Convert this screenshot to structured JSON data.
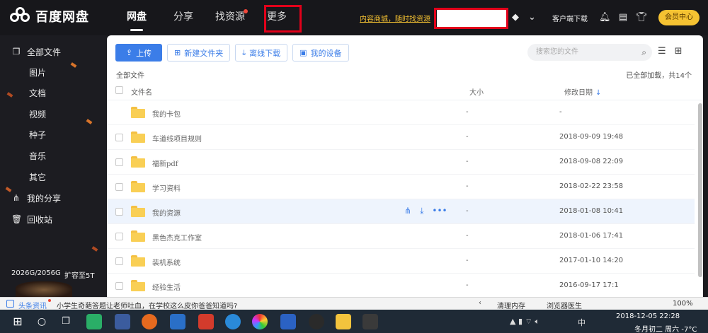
{
  "app": {
    "logo_text": "百度网盘"
  },
  "nav": {
    "items": [
      {
        "label": "网盘"
      },
      {
        "label": "分享"
      },
      {
        "label": "找资源"
      },
      {
        "label": "更多"
      }
    ]
  },
  "header": {
    "promo_link": "内容商城，随时找资源",
    "client_download": "客户端下载",
    "vip_button": "会员中心"
  },
  "sidebar": {
    "items": [
      {
        "label": "全部文件",
        "icon": "all-files-icon"
      },
      {
        "label": "图片"
      },
      {
        "label": "文档"
      },
      {
        "label": "视频"
      },
      {
        "label": "种子"
      },
      {
        "label": "音乐"
      },
      {
        "label": "其它"
      },
      {
        "label": "我的分享",
        "icon": "share-icon"
      },
      {
        "label": "回收站",
        "icon": "trash-icon"
      }
    ],
    "storage": "2026G/2056G",
    "expand": "扩容至5T"
  },
  "toolbar": {
    "upload": "上传",
    "new_folder": "新建文件夹",
    "offline_download": "离线下载",
    "my_devices": "我的设备"
  },
  "search": {
    "placeholder": "搜索您的文件"
  },
  "breadcrumb": "全部文件",
  "loaded_status": "已全部加载，共14个",
  "table": {
    "headers": {
      "name": "文件名",
      "size": "大小",
      "date": "修改日期"
    },
    "rows": [
      {
        "name": "我的卡包",
        "size": "-",
        "date": "-"
      },
      {
        "name": "车道线项目规则",
        "size": "-",
        "date": "2018-09-09 19:48"
      },
      {
        "name": "福新pdf",
        "size": "-",
        "date": "2018-09-08 22:09"
      },
      {
        "name": "学习资料",
        "size": "-",
        "date": "2018-02-22 23:58"
      },
      {
        "name": "我的资源",
        "size": "-",
        "date": "2018-01-08 10:41"
      },
      {
        "name": "黑色杰克工作室",
        "size": "-",
        "date": "2018-01-06 17:41"
      },
      {
        "name": "装机系统",
        "size": "-",
        "date": "2017-01-10 14:20"
      },
      {
        "name": "经验生活",
        "size": "-",
        "date": "2016-09-17 17:1"
      }
    ]
  },
  "statusbar": {
    "news_label": "头条资讯",
    "news_text": "小学生奇葩答题让老师吐血，在学校这么皮你爸爸知道吗?",
    "clean_memory": "清理内存",
    "browser_doctor": "浏览器医生",
    "zoom": "100%"
  },
  "taskbar": {
    "time": "2018-12-05 22:28",
    "date": "冬月初二 周六 -7°C",
    "lang": "中"
  },
  "colors": {
    "accent": "#3b7de8",
    "vip": "#f5c232",
    "highlight_box": "#e2001a",
    "folder": "#f9cf55"
  }
}
